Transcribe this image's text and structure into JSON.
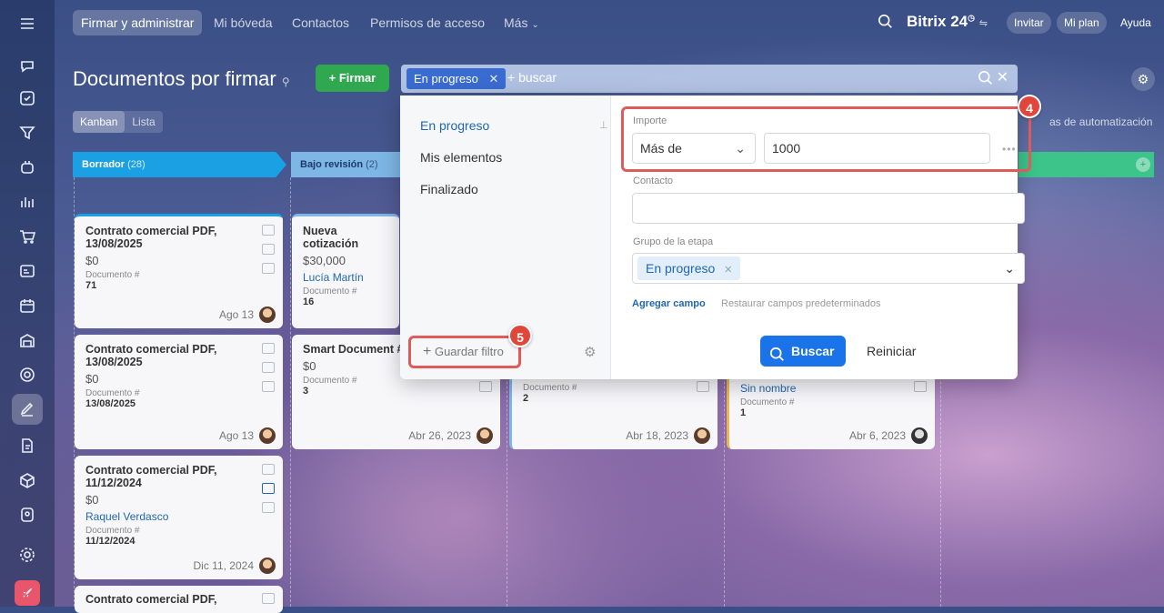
{
  "nav": {
    "items": [
      "Firmar y administrar",
      "Mi bóveda",
      "Contactos",
      "Permisos de acceso",
      "Más"
    ],
    "brand": "Bitrix",
    "brand_num": "24",
    "invite": "Invitar",
    "plan": "Mi plan",
    "help": "Ayuda"
  },
  "page": {
    "title": "Documentos por firmar",
    "sign_button": "+ Firmar",
    "view_tabs": [
      "Kanban",
      "Lista"
    ],
    "automation": "as de automatización"
  },
  "columns": [
    {
      "name": "Borrador",
      "count": "(28)",
      "color": "#1aa0e3"
    },
    {
      "name": "Bajo revisión",
      "count": "(2)",
      "color": "#7eb6e6"
    }
  ],
  "cards": [
    {
      "title": "Contrato comercial PDF, 13/08/2025",
      "amount": "$0",
      "contact": "",
      "doc_label": "Documento #",
      "doc_num": "71",
      "date": "Ago 13"
    },
    {
      "title": "Nueva cotización",
      "amount": "$30,000",
      "contact": "Lucía Martín",
      "doc_label": "Documento #",
      "doc_num": "16",
      "date": ""
    },
    {
      "title": "Contrato comercial PDF, 13/08/2025",
      "amount": "$0",
      "contact": "",
      "doc_label": "Documento #",
      "doc_num": "13/08/2025",
      "date": "Ago 13"
    },
    {
      "title": "Smart Document #",
      "amount": "$0",
      "contact": "",
      "doc_label": "Documento #",
      "doc_num": "3",
      "date": "Abr 26, 2023"
    },
    {
      "title": "",
      "amount": "",
      "contact": "",
      "doc_label": "Documento #",
      "doc_num": "2",
      "date": "Abr 18, 2023"
    },
    {
      "title": "",
      "amount": "",
      "contact": "Sin nombre",
      "doc_label": "Documento #",
      "doc_num": "1",
      "date": "Abr 6, 2023"
    },
    {
      "title": "Contrato comercial PDF, 11/12/2024",
      "amount": "$0",
      "contact": "Raquel Verdasco",
      "doc_label": "Documento #",
      "doc_num": "11/12/2024",
      "date": "Dic 11, 2024"
    },
    {
      "title": "Contrato comercial PDF,",
      "amount": "",
      "contact": "",
      "doc_label": "",
      "doc_num": "",
      "date": ""
    }
  ],
  "search": {
    "chip": "En progreso",
    "placeholder": "+ buscar"
  },
  "filter": {
    "presets": [
      "En progreso",
      "Mis elementos",
      "Finalizado"
    ],
    "save_filter": "Guardar filtro",
    "importe_label": "Importe",
    "importe_op": "Más de",
    "importe_value": "1000",
    "contacto_label": "Contacto",
    "contacto_value": "",
    "grupo_label": "Grupo de la etapa",
    "grupo_chip": "En progreso",
    "add_field": "Agregar campo",
    "restore": "Restaurar campos predeterminados",
    "search_btn": "Buscar",
    "reset_btn": "Reiniciar"
  },
  "badges": {
    "b4": "4",
    "b5": "5"
  }
}
